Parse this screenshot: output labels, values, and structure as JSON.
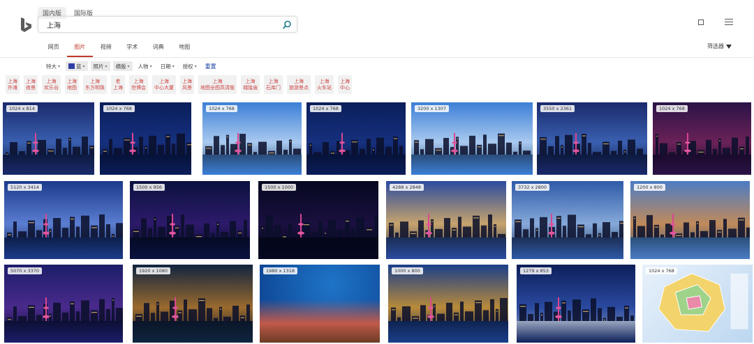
{
  "header": {
    "region_tabs": [
      "国内版",
      "国际版"
    ],
    "query": "上海"
  },
  "scopes": [
    "网页",
    "图片",
    "视频",
    "学术",
    "词典",
    "地图"
  ],
  "active_scope": "图片",
  "filter_label": "筛选器",
  "filters": [
    "特大",
    "蓝",
    "照片",
    "横版",
    "人物",
    "日期",
    "授权"
  ],
  "filter_selected": [
    "蓝",
    "照片",
    "横版"
  ],
  "clear_filters_label": "重置",
  "related": [
    {
      "l1": "上海",
      "l2": "外滩"
    },
    {
      "l1": "上海",
      "l2": "夜景"
    },
    {
      "l1": "上海",
      "l2": "欢乐谷"
    },
    {
      "l1": "上海",
      "l2": "地图"
    },
    {
      "l1": "上海",
      "l2": "东方明珠"
    },
    {
      "l1": "老",
      "l2": "上海"
    },
    {
      "l1": "上海",
      "l2": "世博会"
    },
    {
      "l1": "上海",
      "l2": "中心大厦"
    },
    {
      "l1": "上海",
      "l2": "风景"
    },
    {
      "l1": "上海",
      "l2": "地图全图高清版"
    },
    {
      "l1": "上海",
      "l2": "城隍庙"
    },
    {
      "l1": "上海",
      "l2": "石库门"
    },
    {
      "l1": "上海",
      "l2": "旅游景点"
    },
    {
      "l1": "上海",
      "l2": "火车站"
    },
    {
      "l1": "上海",
      "l2": "中心"
    }
  ],
  "images": [
    {
      "size": "1024 x 814",
      "theme": "dusk"
    },
    {
      "size": "1024 x 768",
      "theme": "night-blue"
    },
    {
      "size": "1024 x 768",
      "theme": "day-clouds"
    },
    {
      "size": "1024 x 768",
      "theme": "night-blue"
    },
    {
      "size": "3200 x 1307",
      "theme": "day-clouds"
    },
    {
      "size": "3550 x 2361",
      "theme": "dusk"
    },
    {
      "size": "1024 x 768",
      "theme": "night-pink"
    },
    {
      "size": "5120 x 3414",
      "theme": "storm"
    },
    {
      "size": "1500 x 956",
      "theme": "night-neon"
    },
    {
      "size": "1500 x 1000",
      "theme": "night-dark"
    },
    {
      "size": "4288 x 2848",
      "theme": "aerial-dusk"
    },
    {
      "size": "3732 x 2800",
      "theme": "towers"
    },
    {
      "size": "1200 x 800",
      "theme": "river-aerial"
    },
    {
      "size": "5070 x 3370",
      "theme": "night-purple"
    },
    {
      "size": "1920 x 1080",
      "theme": "aerial-night"
    },
    {
      "size": "1980 x 1318",
      "theme": "reef"
    },
    {
      "size": "1000 x 800",
      "theme": "glass"
    },
    {
      "size": "1279 x 853",
      "theme": "station"
    },
    {
      "size": "1024 x 768",
      "theme": "map"
    }
  ],
  "colors": {
    "accent": "#c0392b",
    "chip_text": "#cc4444",
    "swatch_blue": "#2f3fa6"
  }
}
